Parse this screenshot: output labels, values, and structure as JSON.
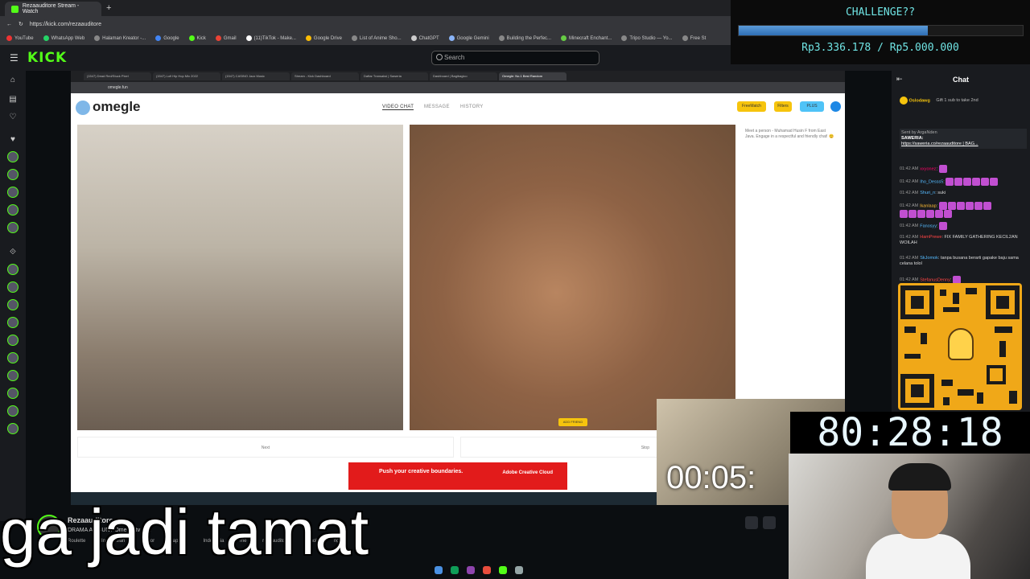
{
  "browser": {
    "tab_title": "Rezaauditore Stream - Watch",
    "url": "https://kick.com/rezaauditore",
    "bookmarks": [
      "YouTube",
      "WhatsApp Web",
      "Halaman Kreator -...",
      "Google",
      "Kick",
      "Gmail",
      "(11)TikTok - Make...",
      "Google Drive",
      "List of Anime Sho...",
      "ChatGPT",
      "Google Gemini",
      "Building the Perfec...",
      "Minecraft Enchant...",
      "Tripo Studio — Yo...",
      "Free St"
    ]
  },
  "kick": {
    "logo": "KICK",
    "search_placeholder": "Search"
  },
  "inner_browser": {
    "tabs": [
      "(1547) Dead Red/Stuck Pixel",
      "(1547) Lofi Hip Hop Mix 2022",
      "(1547) CASINO Jazz Music",
      "Stream - Kick Dashboard",
      "Daftar Transaksi | Saweria",
      "Dashboard | Bagibagico",
      "Omegle: No.1 Best Random"
    ],
    "url": "omegle.fun"
  },
  "omegle": {
    "logo": "omegle",
    "nav": [
      "VIDEO CHAT",
      "MESSAGE",
      "HISTORY"
    ],
    "pills": [
      "FreeMatch",
      "Filters",
      "PLUS"
    ],
    "chat_info": "Meet a person - Muhamad Husin F from East Java. Engage in a respectful and friendly chat! 😊",
    "add_friend": "ADD FRIEND",
    "next_label": "Next",
    "stop_label": "Stop",
    "ad_text": "Push your creative boundaries.",
    "ad_brand": "Adobe Creative Cloud"
  },
  "chat": {
    "title": "Chat",
    "gifter": "Oslodawg",
    "gift_note": "Gift 1 sub to take 2nd",
    "pinned_sender": "Sent by ArgaNden",
    "pinned_text": "SAWERIA:",
    "pinned_link": "https://saweria.co/rezaauditore | BAG...",
    "messages": [
      {
        "time": "01:42 AM",
        "user": "xxyonez",
        "text": "",
        "emotes": 1
      },
      {
        "time": "01:42 AM",
        "user": "Iho_Desss5",
        "text": "",
        "emotes": 6
      },
      {
        "time": "01:42 AM",
        "user": "Shuri_n",
        "text": "suki",
        "emotes": 0
      },
      {
        "time": "01:42 AM",
        "user": "lkanlaap",
        "text": "",
        "emotes": 12
      },
      {
        "time": "01:42 AM",
        "user": "Fanosyy",
        "text": "",
        "emotes": 1
      },
      {
        "time": "01:42 AM",
        "user": "HamPrewe",
        "text": "FIX FAMILY GATHERING KECIL2AN WOILAH",
        "emotes": 0
      },
      {
        "time": "01:42 AM",
        "user": "SkJomok",
        "text": "tanpa busana berarti gapake baju sama celana tolol",
        "emotes": 0
      },
      {
        "time": "01:42 AM",
        "user": "StefanusDenny",
        "text": "",
        "emotes": 1
      }
    ]
  },
  "challenge": {
    "title": "CHALLENGE??",
    "progress": 0.667,
    "amount": "Rp3.336.178 / Rp5.000.000"
  },
  "timers": {
    "big": "80:28:18",
    "small": "00:05:"
  },
  "stream": {
    "streamer": "Rezaauditore",
    "title": "DRAMA ASIBUN? Omegle tv – ...",
    "tags": [
      "Roulette",
      "Indonesian",
      "Horror",
      "yapping",
      "Indonesia",
      "me",
      "rezaauditore",
      "jomok",
      "ngopi"
    ]
  },
  "caption": "ga jadi tamat",
  "colors": {
    "kick_green": "#53fc18",
    "overlay_text": "#6fe3e3",
    "progress_fill": "#2f6fb4",
    "qr_bg": "#f0a818"
  }
}
